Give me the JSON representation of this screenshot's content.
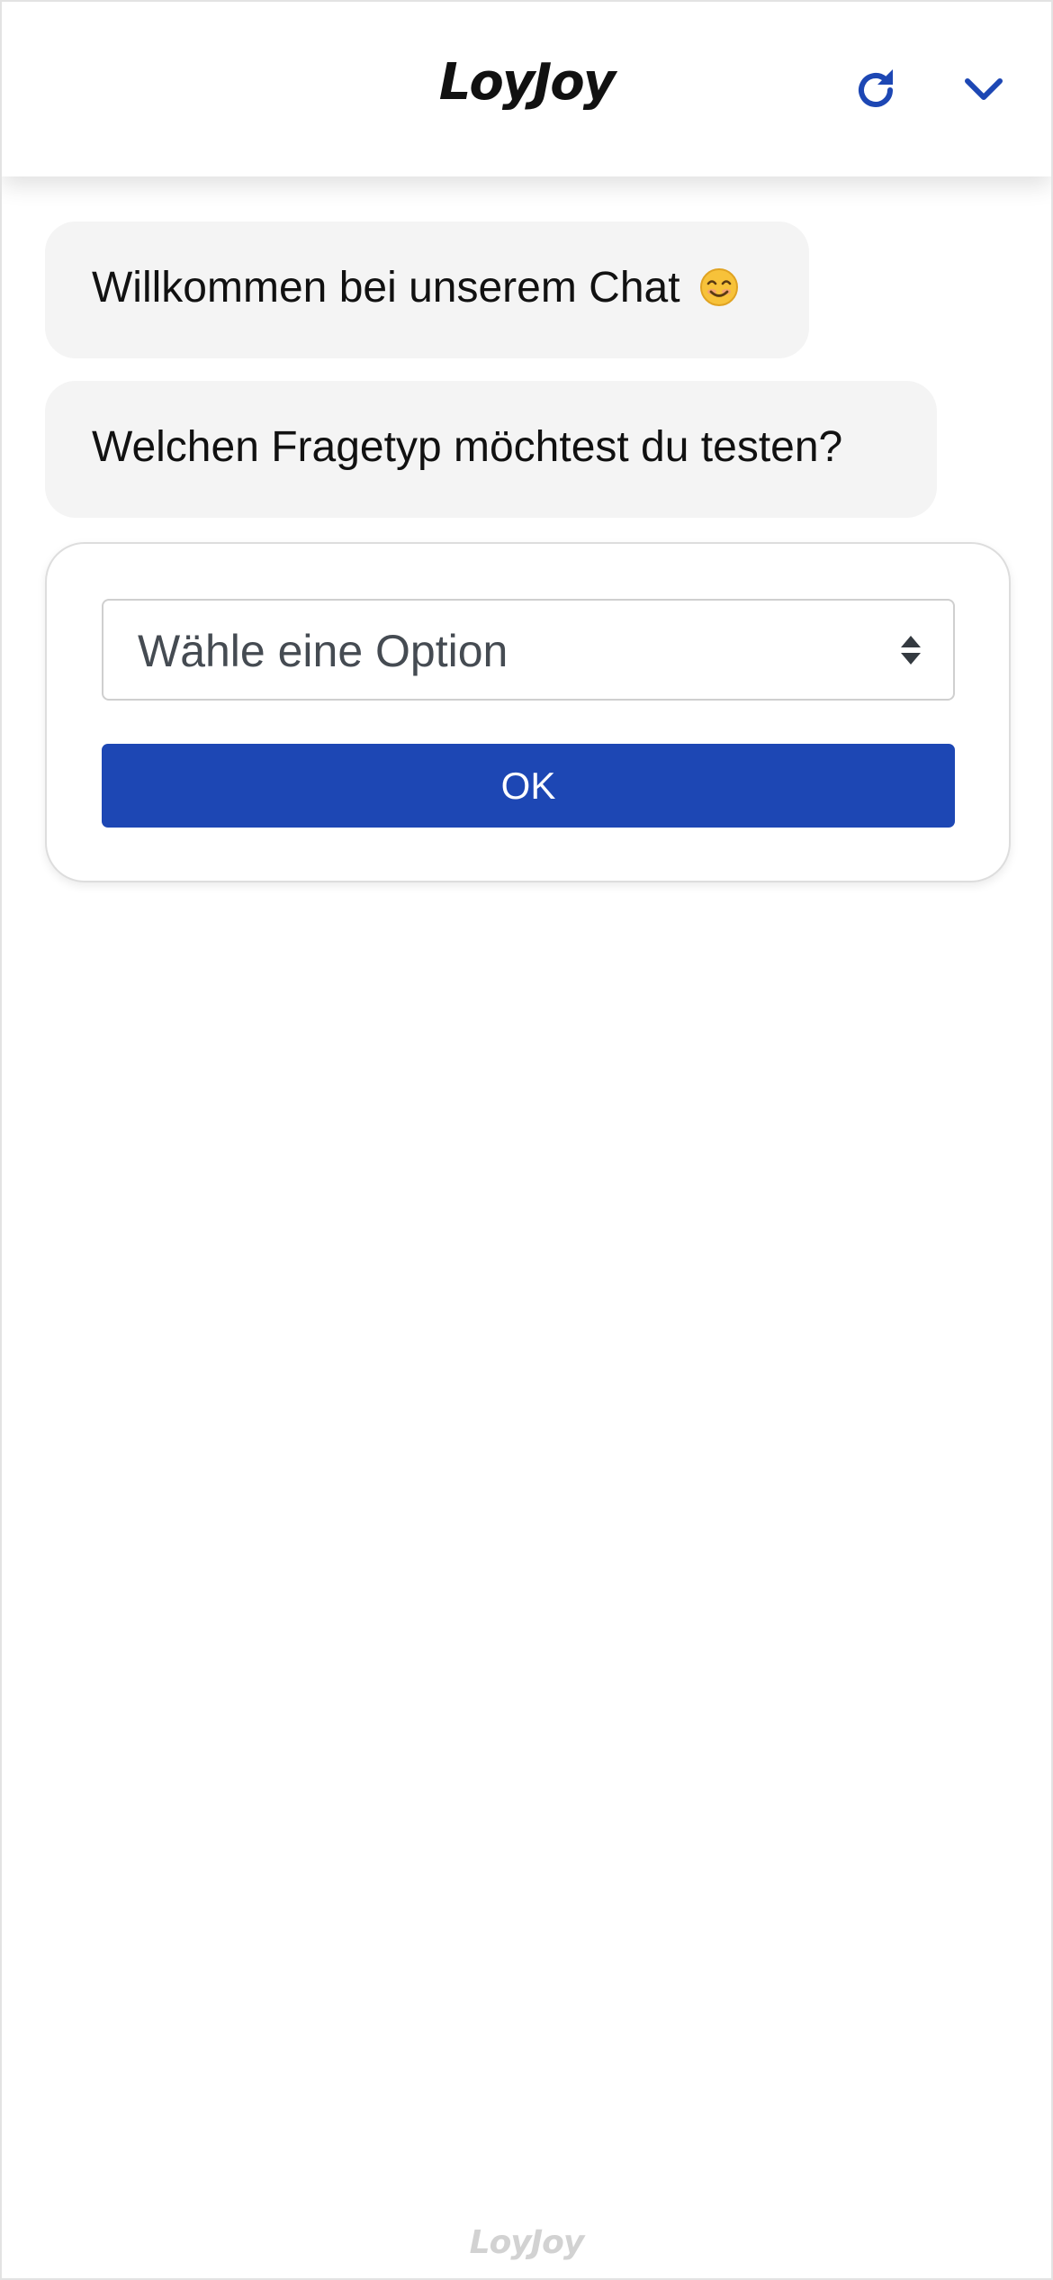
{
  "header": {
    "brand": "LoyJoy",
    "refresh_icon": "refresh-icon",
    "collapse_icon": "chevron-down-icon",
    "accent_color": "#1d47b4"
  },
  "messages": [
    {
      "text": "Willkommen bei unserem Chat",
      "emoji_icon": "smiling-face-emoji-icon"
    },
    {
      "text": "Welchen Fragetyp möchtest du testen?"
    }
  ],
  "form": {
    "select_placeholder": "Wähle eine Option",
    "select_icon": "select-arrows-icon",
    "ok_label": "OK",
    "button_color": "#1d47b4"
  },
  "footer": {
    "brand": "LoyJoy"
  }
}
